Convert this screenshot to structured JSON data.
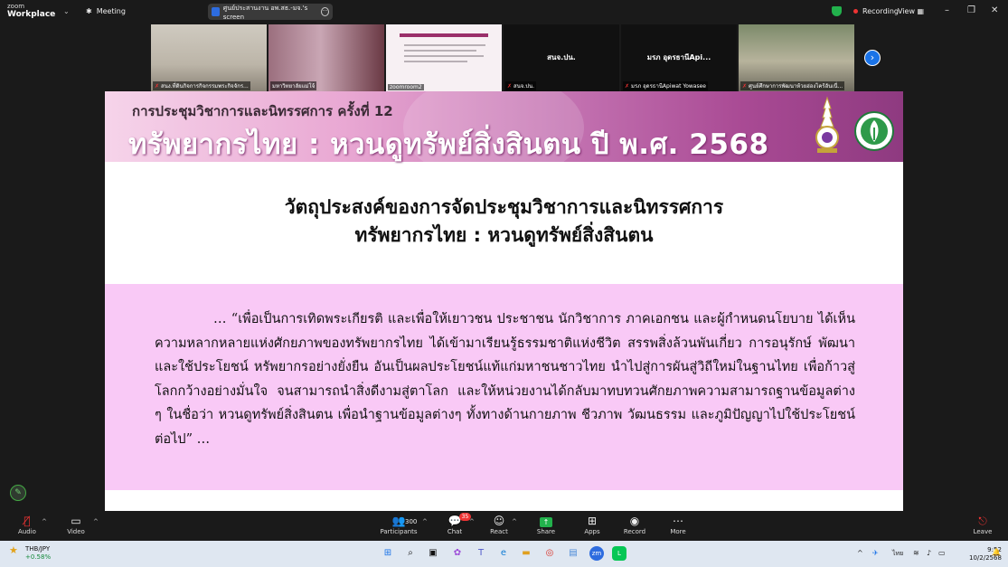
{
  "app": {
    "logo_line1": "zoom",
    "logo_line2": "Workplace",
    "meeting_label": "Meeting",
    "share_title": "ศูนย์ประสานงาน อพ.สธ.-มจ.'s screen",
    "recording_label": "Recording",
    "view_label": "View"
  },
  "participants": [
    {
      "label": "สนง.ที่ดินกิจการกิจกรรมพระกิจจักร...",
      "muted": true
    },
    {
      "label": "มหาวิทยาลัยแม่โจ้",
      "muted": false
    },
    {
      "label": "zoomroom2",
      "muted": false
    },
    {
      "label": "สนจ.ปน.",
      "muted": true,
      "center_name": "สนจ.ปน."
    },
    {
      "label": "มรภ อุดรธานีApiwat Yowasee",
      "muted": true,
      "center_name": "มรภ อุดรธานีApi..."
    },
    {
      "label": "ศูนย์ศึกษาการพัฒนาห้วยฮ่องไคร้อันเนื่...",
      "muted": true
    }
  ],
  "slide": {
    "subtitle": "การประชุมวิชาการและนิทรรศการ ครั้งที่ 12",
    "banner_title": "ทรัพยากรไทย : หวนดูทรัพย์สิ่งสินตน ปี พ.ศ. 2568",
    "heading_line1": "วัตถุประสงค์ของการจัดประชุมวิชาการและนิทรรศการ",
    "heading_line2": "ทรัพยากรไทย : หวนดูทรัพย์สิ่งสินตน",
    "quote": "… “เพื่อเป็นการเทิดพระเกียรติ และเพื่อให้เยาวชน ประชาชน นักวิชาการ ภาคเอกชน และผู้กำหนดนโยบาย ได้เห็นความหลากหลายแห่งศักยภาพของทรัพยากรไทย ได้เข้ามาเรียนรู้ธรรมชาติแห่งชีวิต สรรพสิ่งล้วนพันเกี่ยว การอนุรักษ์ พัฒนา และใช้ประโยชน์ หรัพยากรอย่างยั่งยืน อันเป็นผลประโยชน์แท้แก่มหาชนชาวไทย นำไปสู่การผันสู่วิถีใหม่ในฐานไทย เพื่อก้าวสู่โลกกว้างอย่างมั่นใจ จนสามารถนำสิ่งดีงามสู่ตาโลก และให้หน่วยงานได้กลับมาทบทวนศักยภาพความสามารถฐานข้อมูลต่าง ๆ ในชื่อว่า หวนดูทรัพย์สิ่งสินตน เพื่อนำฐานข้อมูลต่างๆ  ทั้งทางด้านกายภาพ ชีวภาพ วัฒนธรรม และภูมิปัญญาไปใช้ประโยชน์ต่อไป” …"
  },
  "toolbar": {
    "audio": "Audio",
    "video": "Video",
    "participants": "Participants",
    "participants_count": "300",
    "chat": "Chat",
    "chat_badge": "35",
    "react": "React",
    "share": "Share",
    "apps": "Apps",
    "record": "Record",
    "more": "More",
    "leave": "Leave"
  },
  "taskbar": {
    "ticker": "THB/JPY",
    "ticker_change": "+0.58%",
    "notif_count": "1",
    "lang": "ไทย",
    "time": "9:52",
    "date": "10/2/2568"
  },
  "colors": {
    "accent_green": "#22c55e",
    "quote_bg": "#f9c9f6",
    "banner_purple": "#a94a94",
    "recording_red": "#e33333"
  }
}
